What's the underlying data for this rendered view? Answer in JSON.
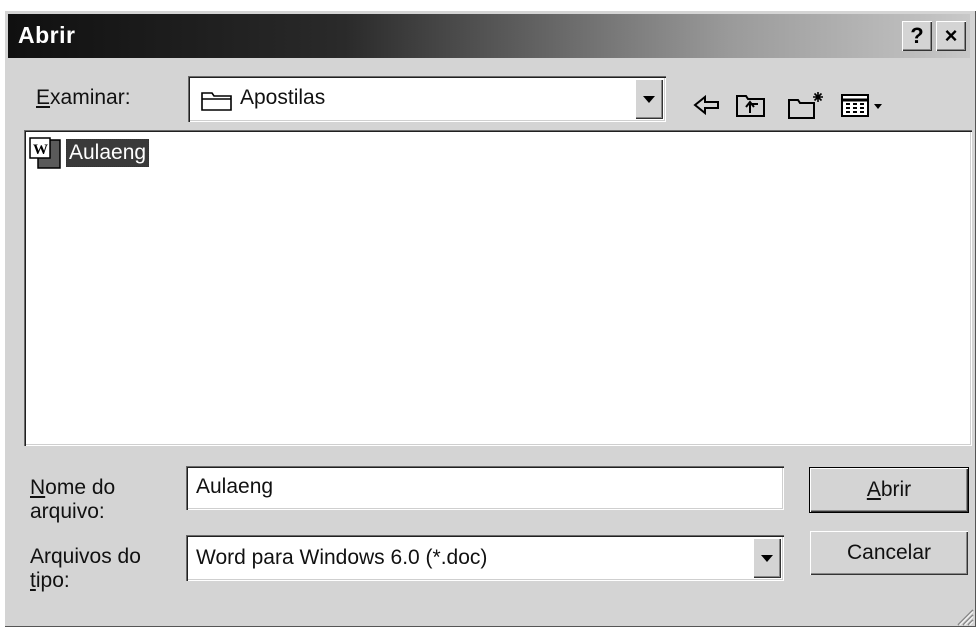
{
  "window": {
    "title": "Abrir"
  },
  "titlebar": {
    "help_label": "?",
    "close_label": "×"
  },
  "lookin": {
    "label": "Examinar:",
    "mnemonic_label_rest": "xaminar:",
    "mnemonic": "E",
    "value": "Apostilas"
  },
  "toolbar": {
    "back_icon": "back-arrow-icon",
    "up_icon": "up-one-level-icon",
    "newfolder_icon": "new-folder-icon",
    "view_icon": "view-menu-icon"
  },
  "files": [
    {
      "name": "Aulaeng",
      "icon": "word-document-icon"
    }
  ],
  "filename": {
    "label_line1_mn": "N",
    "label_line1_rest": "ome do",
    "label_line2": "arquivo:",
    "value": "Aulaeng"
  },
  "filetype": {
    "label_line1": "Arquivos do",
    "label_line2_mn": "t",
    "label_line2_rest": "ipo:",
    "value": "Word para Windows 6.0 (*.doc)"
  },
  "buttons": {
    "open_mn": "A",
    "open_rest": "brir",
    "cancel": "Cancelar"
  }
}
